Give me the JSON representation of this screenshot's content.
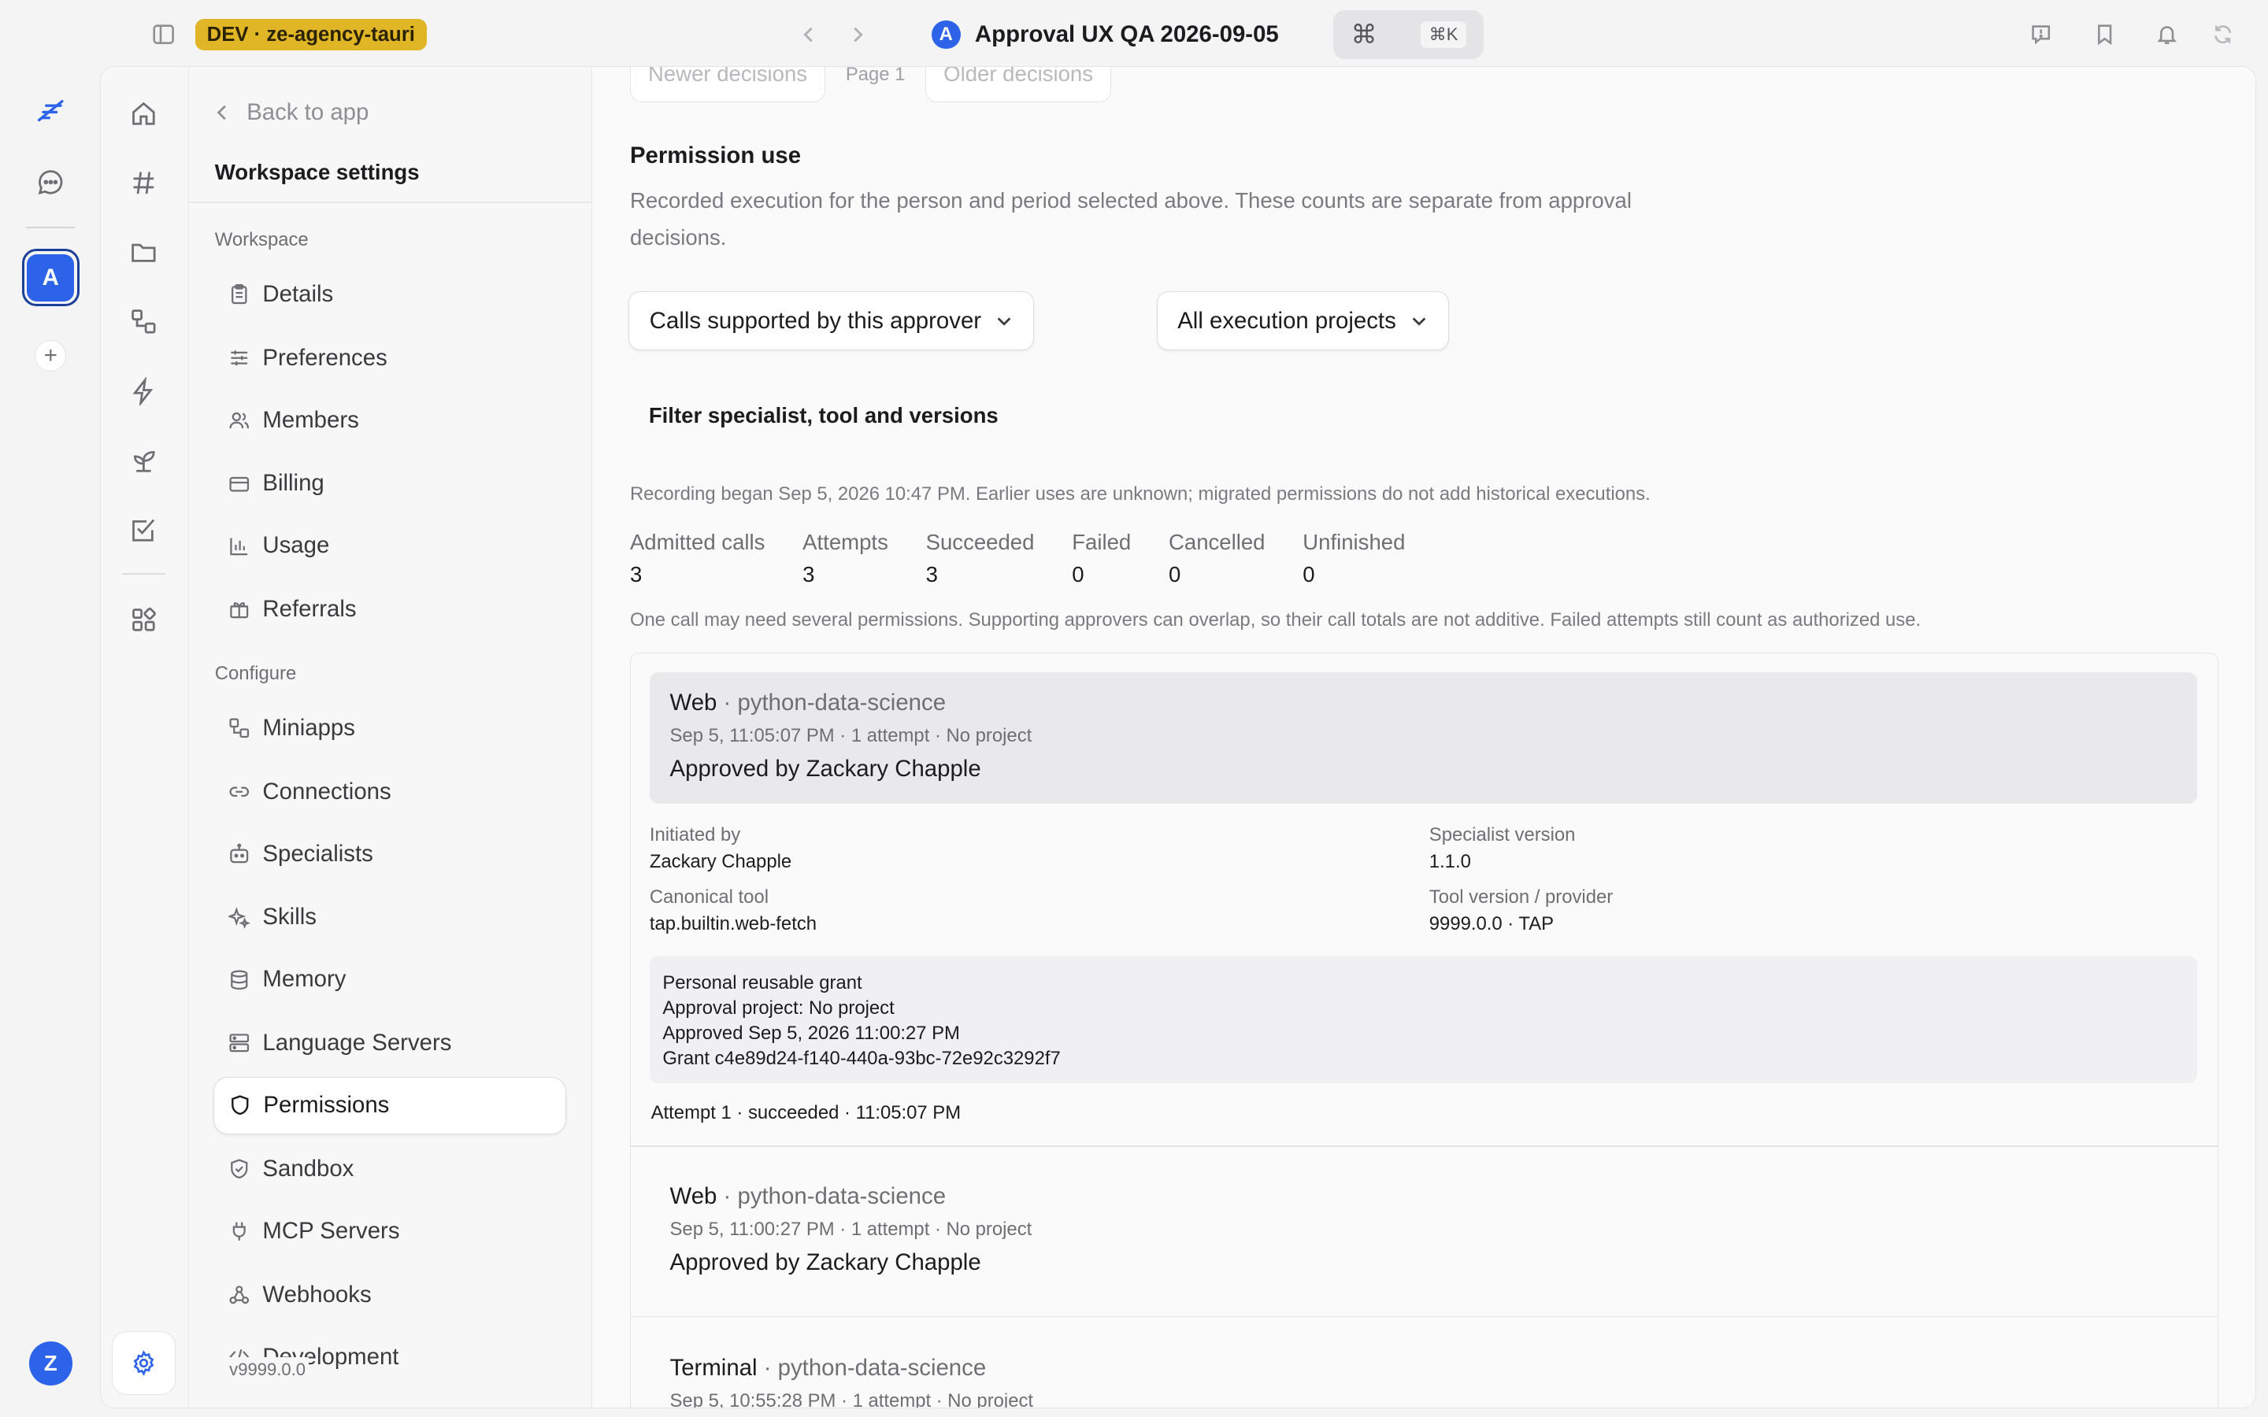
{
  "topbar": {
    "dev_badge": "DEV · ze-agency-tauri",
    "title_avatar": "A",
    "title": "Approval UX QA 2026-09-05",
    "cmdk_symbol": "⌘",
    "cmdk_shortcut": "⌘K"
  },
  "rail": {
    "workspace_avatar": "A",
    "add_label": "+",
    "user_avatar": "Z"
  },
  "sidebar": {
    "back_label": "Back to app",
    "title": "Workspace settings",
    "sections": {
      "workspace": "Workspace",
      "configure": "Configure"
    },
    "workspace_items": [
      {
        "label": "Details",
        "icon": "clipboard-icon"
      },
      {
        "label": "Preferences",
        "icon": "sliders-icon"
      },
      {
        "label": "Members",
        "icon": "users-icon"
      },
      {
        "label": "Billing",
        "icon": "credit-card-icon"
      },
      {
        "label": "Usage",
        "icon": "bar-chart-icon"
      },
      {
        "label": "Referrals",
        "icon": "gift-icon"
      }
    ],
    "configure_items": [
      {
        "label": "Miniapps",
        "icon": "miniapps-icon"
      },
      {
        "label": "Connections",
        "icon": "link-icon"
      },
      {
        "label": "Specialists",
        "icon": "bot-icon"
      },
      {
        "label": "Skills",
        "icon": "sparkles-icon"
      },
      {
        "label": "Memory",
        "icon": "database-icon"
      },
      {
        "label": "Language Servers",
        "icon": "server-icon"
      },
      {
        "label": "Permissions",
        "icon": "shield-icon",
        "active": true
      },
      {
        "label": "Sandbox",
        "icon": "shield-check-icon"
      },
      {
        "label": "MCP Servers",
        "icon": "plug-icon"
      },
      {
        "label": "Webhooks",
        "icon": "webhook-icon"
      },
      {
        "label": "Development",
        "icon": "code-icon"
      }
    ],
    "version": "v9999.0.0"
  },
  "main": {
    "pager": {
      "newer": "Newer decisions",
      "page": "Page 1",
      "older": "Older decisions"
    },
    "permission_use": {
      "heading": "Permission use",
      "description": "Recorded execution for the person and period selected above. These counts are separate from approval decisions."
    },
    "filters": {
      "calls_select": "Calls supported by this approver",
      "projects_select": "All execution projects",
      "filter_link": "Filter specialist, tool and versions"
    },
    "recording_note": "Recording began Sep 5, 2026 10:47 PM. Earlier uses are unknown; migrated permissions do not add historical executions.",
    "stats": [
      {
        "label": "Admitted calls",
        "value": "3"
      },
      {
        "label": "Attempts",
        "value": "3"
      },
      {
        "label": "Succeeded",
        "value": "3"
      },
      {
        "label": "Failed",
        "value": "0"
      },
      {
        "label": "Cancelled",
        "value": "0"
      },
      {
        "label": "Unfinished",
        "value": "0"
      }
    ],
    "overlap_note": "One call may need several permissions. Supporting approvers can overlap, so their call totals are not additive. Failed attempts still count as authorized use.",
    "calls": [
      {
        "tool": "Web",
        "separator": " · ",
        "specialist": "python-data-science",
        "meta": "Sep 5, 11:05:07 PM · 1 attempt · No project",
        "approval": "Approved by Zackary Chapple",
        "details": {
          "initiated_by_label": "Initiated by",
          "initiated_by": "Zackary Chapple",
          "specialist_version_label": "Specialist version",
          "specialist_version": "1.1.0",
          "canonical_tool_label": "Canonical tool",
          "canonical_tool": "tap.builtin.web-fetch",
          "tool_version_label": "Tool version / provider",
          "tool_version": "9999.0.0 · TAP",
          "grant_lines": [
            "Personal reusable grant",
            "Approval project: No project",
            "Approved Sep 5, 2026 11:00:27 PM",
            "Grant c4e89d24-f140-440a-93bc-72e92c3292f7"
          ],
          "attempt": "Attempt 1 · succeeded · 11:05:07 PM"
        }
      },
      {
        "tool": "Web",
        "separator": " · ",
        "specialist": "python-data-science",
        "meta": "Sep 5, 11:00:27 PM · 1 attempt · No project",
        "approval": "Approved by Zackary Chapple"
      },
      {
        "tool": "Terminal",
        "separator": " · ",
        "specialist": "python-data-science",
        "meta": "Sep 5, 10:55:28 PM · 1 attempt · No project"
      }
    ]
  }
}
